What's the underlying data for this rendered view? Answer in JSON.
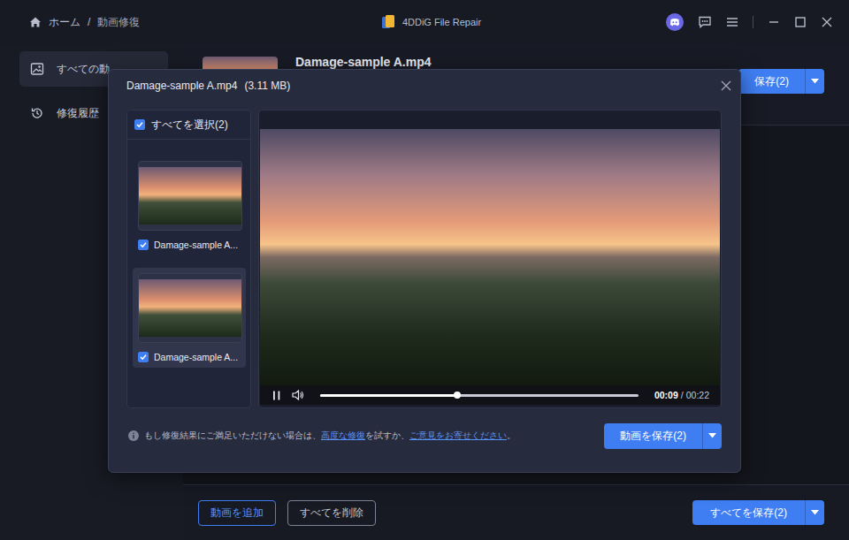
{
  "window": {
    "title": "4DDiG File Repair"
  },
  "breadcrumb": [
    {
      "label": "ホーム"
    },
    {
      "label": "/"
    },
    {
      "label": "動画修復"
    }
  ],
  "sidebar": {
    "items": [
      {
        "label": "すべての動",
        "selected": true
      },
      {
        "label": "修復履歴",
        "selected": false
      }
    ]
  },
  "header": {
    "file_name": "Damage-sample A.mp4",
    "save_button": "保存(2)"
  },
  "footer": {
    "add_button": "動画を追加",
    "delete_button": "すべてを削除",
    "save_all_button": "すべてを保存(2)"
  },
  "dialog": {
    "title": "Damage-sample A.mp4",
    "size": "(3.11 MB)",
    "select_all": {
      "label": "すべてを選択(2)",
      "checked": true
    },
    "files": [
      {
        "name": "Damage-sample A...",
        "checked": true,
        "selected": false
      },
      {
        "name": "Damage-sample A...",
        "checked": true,
        "selected": true
      }
    ],
    "player": {
      "playing": true,
      "level": 0.43,
      "elapsed": "00:09",
      "separator": "/",
      "duration": "00:22"
    },
    "notice": [
      {
        "text": "もし修復結果にご満足いただけない場合は、",
        "link": false
      },
      {
        "text": "高度な修復",
        "link": true
      },
      {
        "text": "を試すか、",
        "link": false
      },
      {
        "text": "ご意見をお寄せください",
        "link": true
      },
      {
        "text": "。",
        "link": false
      }
    ],
    "save_button": "動画を保存(2)"
  }
}
